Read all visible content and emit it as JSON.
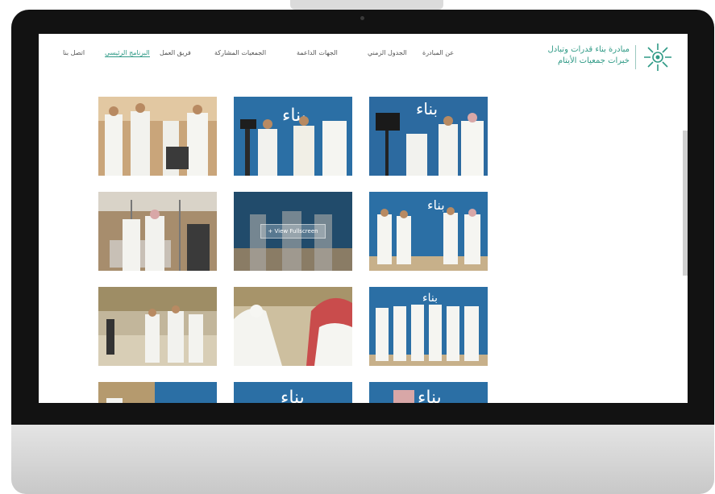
{
  "nav": {
    "items": [
      "اتصل بنا",
      "البرنامج الرئيسي",
      "فريق العمل",
      "الجمعيات المشاركة",
      "الجهات الداعمة",
      "الجدول الزمني",
      "عن المبادرة"
    ],
    "active_index": 1
  },
  "logo": {
    "line1": "مبادرة بناء قدرات وتبادل",
    "line2": "خبرات جمعيات الأيتام"
  },
  "gallery": {
    "overlay_label": "+ View Fullscreen",
    "tiles": [
      {
        "scene": "people-indoor"
      },
      {
        "scene": "interview-blue"
      },
      {
        "scene": "camera-blue"
      },
      {
        "scene": "hall-people"
      },
      {
        "scene": "overlay-blue"
      },
      {
        "scene": "group-blue"
      },
      {
        "scene": "hall-people"
      },
      {
        "scene": "closeup-shemagh"
      },
      {
        "scene": "group-blue"
      },
      {
        "scene": "bottom-partial"
      },
      {
        "scene": "bottom-blue"
      },
      {
        "scene": "bottom-blue"
      }
    ]
  },
  "colors": {
    "accent": "#2f9a86",
    "banner_blue": "#2b6fa5",
    "bezel": "#121212"
  }
}
